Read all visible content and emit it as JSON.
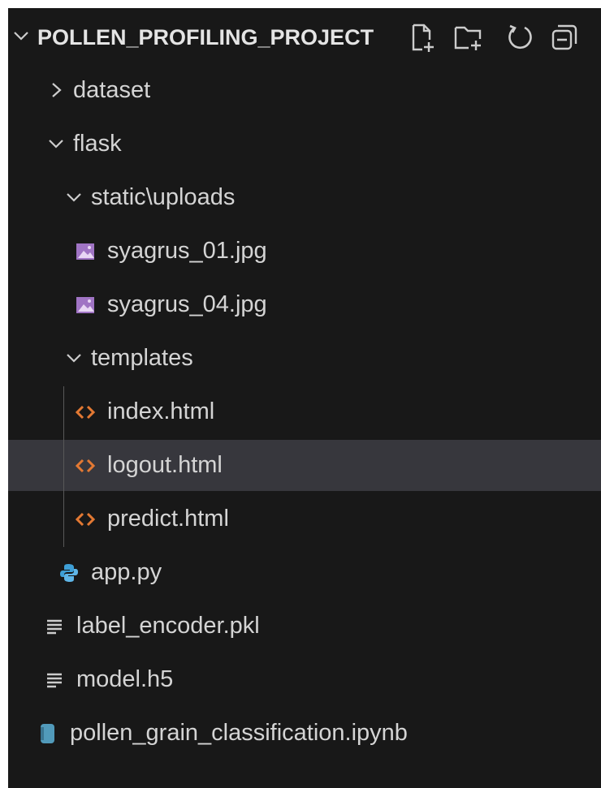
{
  "explorer": {
    "title": "POLLEN_PROFILING_PROJECT",
    "actions": [
      {
        "name": "new-file-icon"
      },
      {
        "name": "new-folder-icon"
      },
      {
        "name": "refresh-icon"
      },
      {
        "name": "collapse-all-icon"
      }
    ],
    "tree": [
      {
        "label": "dataset",
        "kind": "folder",
        "expanded": false,
        "depth": 0
      },
      {
        "label": "flask",
        "kind": "folder",
        "expanded": true,
        "depth": 0
      },
      {
        "label": "static\\uploads",
        "kind": "folder",
        "expanded": true,
        "depth": 1
      },
      {
        "label": "syagrus_01.jpg",
        "kind": "image",
        "depth": 2
      },
      {
        "label": "syagrus_04.jpg",
        "kind": "image",
        "depth": 2
      },
      {
        "label": "templates",
        "kind": "folder",
        "expanded": true,
        "depth": 1
      },
      {
        "label": "index.html",
        "kind": "html",
        "depth": 2
      },
      {
        "label": "logout.html",
        "kind": "html",
        "depth": 2,
        "selected": true
      },
      {
        "label": "predict.html",
        "kind": "html",
        "depth": 2
      },
      {
        "label": "app.py",
        "kind": "python",
        "depth": 1
      },
      {
        "label": "label_encoder.pkl",
        "kind": "text",
        "depth": 0
      },
      {
        "label": "model.h5",
        "kind": "text",
        "depth": 0
      },
      {
        "label": "pollen_grain_classification.ipynb",
        "kind": "notebook",
        "depth": 0
      }
    ]
  },
  "colors": {
    "background": "#181818",
    "selected_row": "#37373d",
    "text": "#d4d4d4",
    "html_icon": "#e37933",
    "image_icon": "#a074c4",
    "python_icon": "#3e9fd6",
    "notebook_icon": "#519aba"
  }
}
